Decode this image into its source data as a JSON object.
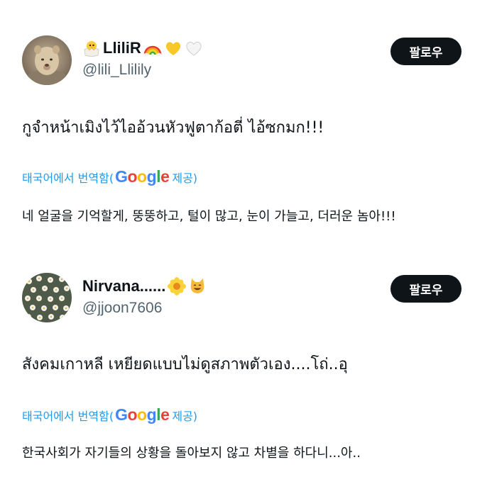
{
  "posts": [
    {
      "display_name": "LliliR",
      "handle": "@lili_Llilily",
      "follow_label": "팔로우",
      "text": "กูจำหน้าเมิงไว้ไออ้วนหัวฟูตาก้อตี่ ไอ้ซกมก!!!",
      "translate_label": "태국어에서 번역함(",
      "provider_suffix": " 제공)",
      "translated_text": "네 얼굴을 기억할게, 뚱뚱하고, 털이 많고, 눈이 가늘고, 더러운 놈아!!!",
      "badges": [
        "hatching-chick-icon",
        "rainbow-icon",
        "yellow-heart-icon",
        "white-heart-icon"
      ]
    },
    {
      "display_name": "Nirvana......",
      "handle": "@jjoon7606",
      "follow_label": "팔로우",
      "text": "สังคมเกาหลี เหยียดแบบไม่ดูสภาพตัวเอง....โถ่..อุ",
      "translate_label": "태국어에서 번역함(",
      "provider_suffix": " 제공)",
      "translated_text": "한국사회가 자기들의 상황을 돌아보지 않고 차별을 하다니...아..",
      "badges": [
        "blossom-icon",
        "cat-face-icon"
      ]
    }
  ],
  "google": {
    "G": "G",
    "o1": "o",
    "o2": "o",
    "g": "g",
    "l": "l",
    "e": "e"
  },
  "colors": {
    "link": "#1d9bf0",
    "text": "#0f1419",
    "muted": "#536471",
    "button_bg": "#0f1419"
  }
}
